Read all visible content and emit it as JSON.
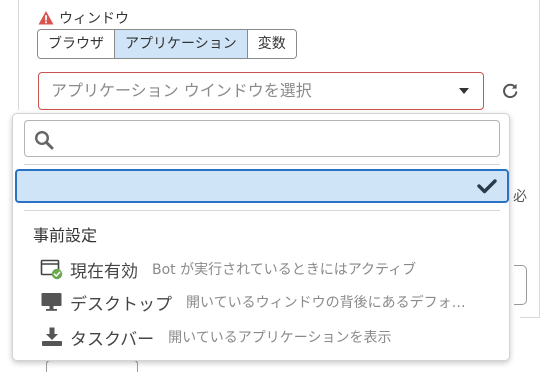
{
  "window": {
    "label": "ウィンドウ"
  },
  "tabs": [
    {
      "label": "ブラウザ",
      "active": false
    },
    {
      "label": "アプリケーション",
      "active": true
    },
    {
      "label": "変数",
      "active": false
    }
  ],
  "app_select": {
    "placeholder": "アプリケーション ウインドウを選択"
  },
  "required_fragment": "必",
  "dropdown": {
    "search_value": "",
    "section_header": "事前設定",
    "presets": [
      {
        "name": "現在有効",
        "description": "Bot が実行されているときにはアクティブ",
        "icon": "active-window-icon"
      },
      {
        "name": "デスクトップ",
        "description": "開いているウィンドウの背後にあるデフォ…",
        "icon": "monitor-icon"
      },
      {
        "name": "タスクバー",
        "description": "開いているアプリケーションを表示",
        "icon": "download-tray-icon"
      }
    ]
  },
  "colors": {
    "accent_blue": "#2a73c4",
    "selection_bg": "#cfe4f7",
    "error_red": "#c9544f",
    "warning_red": "#d9534f",
    "success_green": "#6aa84f"
  }
}
